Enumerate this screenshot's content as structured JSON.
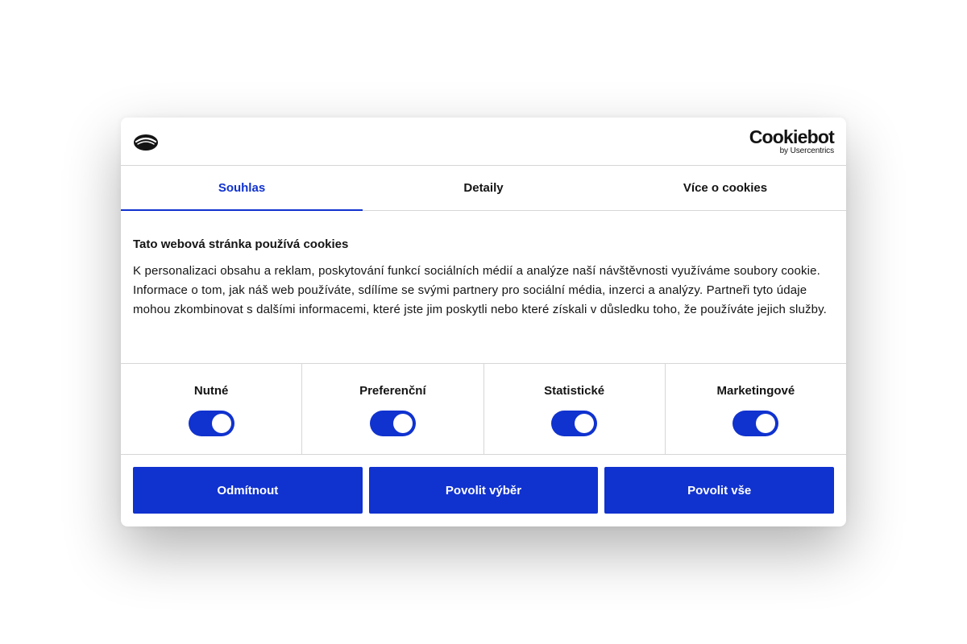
{
  "header": {
    "logo_icon": "cookie-logo-icon",
    "brand_name": "Cookiebot",
    "brand_sub": "by Usercentrics"
  },
  "tabs": [
    {
      "label": "Souhlas",
      "active": true
    },
    {
      "label": "Detaily",
      "active": false
    },
    {
      "label": "Více o cookies",
      "active": false
    }
  ],
  "content": {
    "title": "Tato webová stránka používá cookies",
    "body": "K personalizaci obsahu a reklam, poskytování funkcí sociálních médií a analýze naší návštěvnosti využíváme soubory cookie. Informace o tom, jak náš web používáte, sdílíme se svými partnery pro sociální média, inzerci a analýzy. Partneři tyto údaje mohou zkombinovat s dalšími informacemi, které jste jim poskytli nebo které získali v důsledku toho, že používáte jejich služby."
  },
  "categories": [
    {
      "label": "Nutné",
      "enabled": true
    },
    {
      "label": "Preferenční",
      "enabled": true
    },
    {
      "label": "Statistické",
      "enabled": true
    },
    {
      "label": "Marketingové",
      "enabled": true
    }
  ],
  "buttons": {
    "deny": "Odmítnout",
    "allow_selection": "Povolit výběr",
    "allow_all": "Povolit vše"
  },
  "colors": {
    "accent": "#1032cf",
    "text": "#141414",
    "border": "#d6d6d6"
  }
}
